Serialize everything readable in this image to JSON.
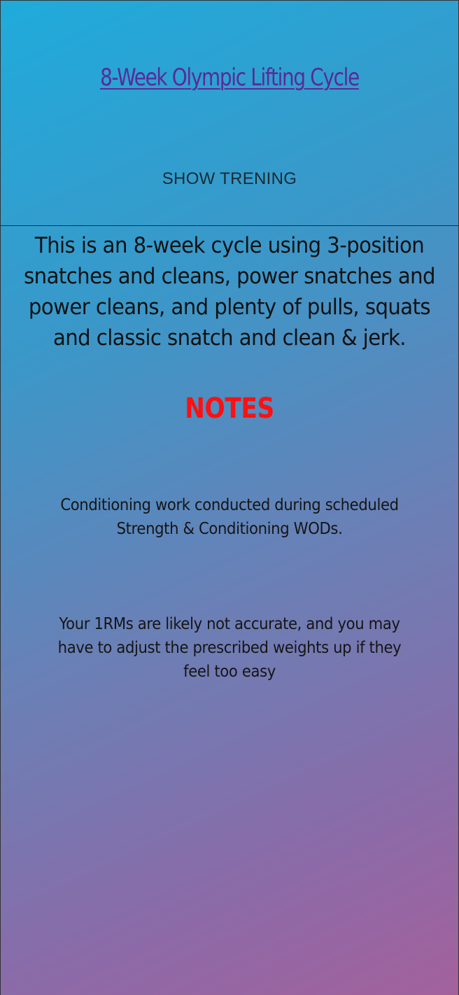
{
  "header": {
    "title": "8-Week Olympic Lifting Cycle",
    "show_button_label": "SHOW TRENING"
  },
  "main": {
    "intro": "This is an 8-week cycle using 3-position snatches and cleans, power snatches and power cleans, and plenty of pulls, squats and classic snatch and clean & jerk.",
    "notes_heading": "NOTES",
    "notes": [
      "Conditioning work conducted during scheduled Strength & Conditioning WODs.",
      "Your 1RMs are likely not accurate, and you may have to adjust the prescribed weights up if they feel too easy"
    ]
  },
  "colors": {
    "gradient_start": "#1fabdb",
    "gradient_end": "#a3619c",
    "title_link": "#5a2a98",
    "notes_heading": "#ff1010"
  }
}
